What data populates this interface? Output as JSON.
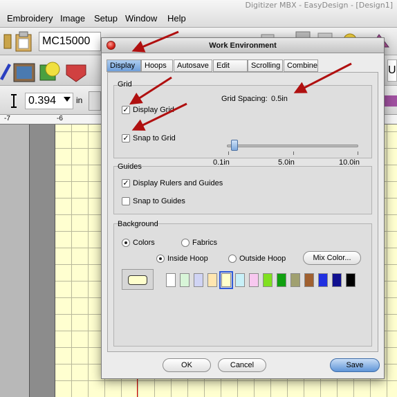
{
  "app": {
    "window_title": "Digitizer MBX - EasyDesign - [Design1]",
    "menu": [
      "Embroidery",
      "Image",
      "Setup",
      "Window",
      "Help"
    ],
    "machine": "MC15000",
    "size_value": "0.394",
    "size_unit": "in",
    "ruler_labels": [
      "-7",
      "-6"
    ],
    "partial_right_label": "U"
  },
  "dialog": {
    "title": "Work Environment",
    "tabs": [
      {
        "label": "Display",
        "active": true
      },
      {
        "label": "Hoops",
        "active": false
      },
      {
        "label": "Autosave",
        "active": false
      },
      {
        "label": "Edit",
        "active": false
      },
      {
        "label": "Scrolling",
        "active": false
      },
      {
        "label": "Combine",
        "active": false
      }
    ],
    "grid": {
      "title": "Grid",
      "display_grid_label": "Display Grid",
      "display_grid_checked": true,
      "snap_to_grid_label": "Snap to Grid",
      "snap_to_grid_checked": true,
      "spacing_label": "Grid Spacing:",
      "spacing_value": "0.5in",
      "slider_min": "0.1in",
      "slider_mid": "5.0in",
      "slider_max": "10.0in",
      "slider_position_in": 0.5
    },
    "guides": {
      "title": "Guides",
      "display_rulers_label": "Display Rulers and Guides",
      "display_rulers_checked": true,
      "snap_to_guides_label": "Snap to Guides",
      "snap_to_guides_checked": false
    },
    "background": {
      "title": "Background",
      "colors_label": "Colors",
      "fabrics_label": "Fabrics",
      "selected_mode": "Colors",
      "inside_hoop_label": "Inside Hoop",
      "outside_hoop_label": "Outside Hoop",
      "selected_hoop": "Inside Hoop",
      "mix_color_label": "Mix Color...",
      "swatches": [
        "#ffffff",
        "#d8f5d8",
        "#d0d4f4",
        "#ffe6b0",
        "#ffffcc",
        "#c8f0f8",
        "#f8c8f0",
        "#80e020",
        "#10a010",
        "#a0a070",
        "#a06030",
        "#2030e0",
        "#101090",
        "#000000"
      ],
      "selected_swatch": 4
    },
    "buttons": {
      "ok": "OK",
      "cancel": "Cancel",
      "save": "Save"
    }
  },
  "colors": {
    "annotation_arrow": "#b01010",
    "active_tab": "#6f9fda",
    "fabric": "#ffffd0"
  }
}
